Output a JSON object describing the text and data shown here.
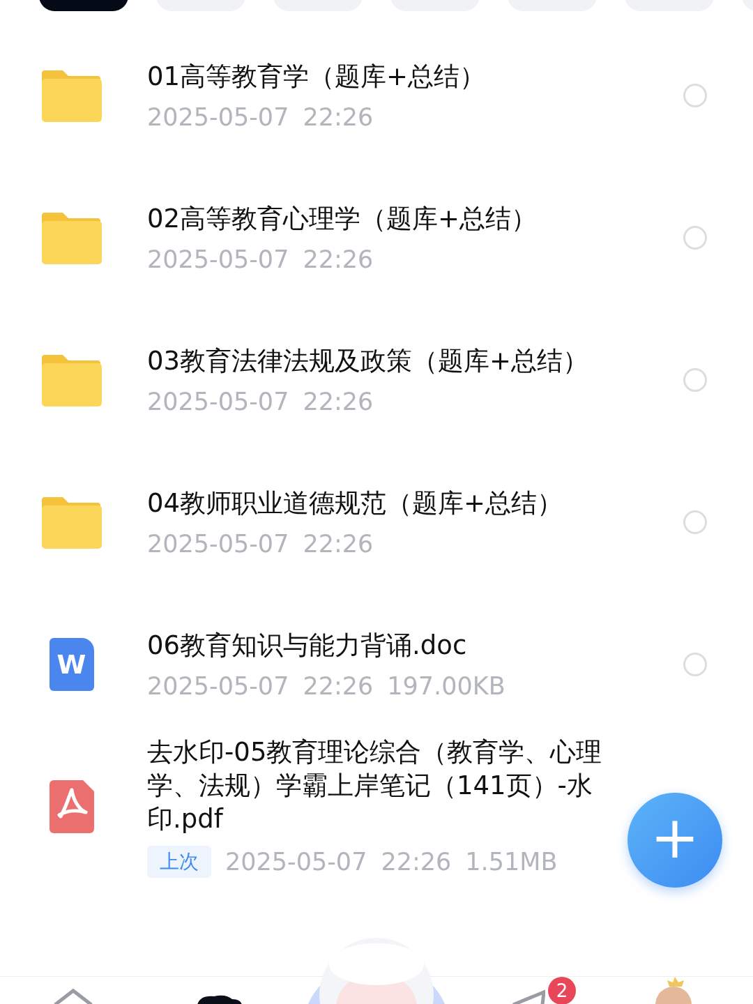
{
  "filter_tabs": [
    {
      "selected": true
    },
    {
      "selected": false
    },
    {
      "selected": false
    },
    {
      "selected": false
    },
    {
      "selected": false
    },
    {
      "selected": false
    },
    {
      "selected": false
    }
  ],
  "files": [
    {
      "kind": "folder",
      "name": "01高等教育学（题库+总结）",
      "date": "2025-05-07",
      "time": "22:26",
      "selected": false
    },
    {
      "kind": "folder",
      "name": "02高等教育心理学（题库+总结）",
      "date": "2025-05-07",
      "time": "22:26",
      "selected": false
    },
    {
      "kind": "folder",
      "name": "03教育法律法规及政策（题库+总结）",
      "date": "2025-05-07",
      "time": "22:26",
      "selected": false
    },
    {
      "kind": "folder",
      "name": "04教师职业道德规范（题库+总结）",
      "date": "2025-05-07",
      "time": "22:26",
      "selected": false
    },
    {
      "kind": "word",
      "icon_letter": "W",
      "name": "06教育知识与能力背诵.doc",
      "date": "2025-05-07",
      "time": "22:26",
      "size": "197.00KB",
      "selected": false
    },
    {
      "kind": "pdf",
      "name": "去水印-05教育理论综合（教育学、心理学、法规）学霸上岸笔记（141页）-水印.pdf",
      "tag": "上次",
      "date": "2025-05-07",
      "time": "22:26",
      "size": "1.51MB"
    }
  ],
  "fab": {
    "label": "+"
  },
  "bottom_nav": {
    "messages_badge": "2"
  }
}
